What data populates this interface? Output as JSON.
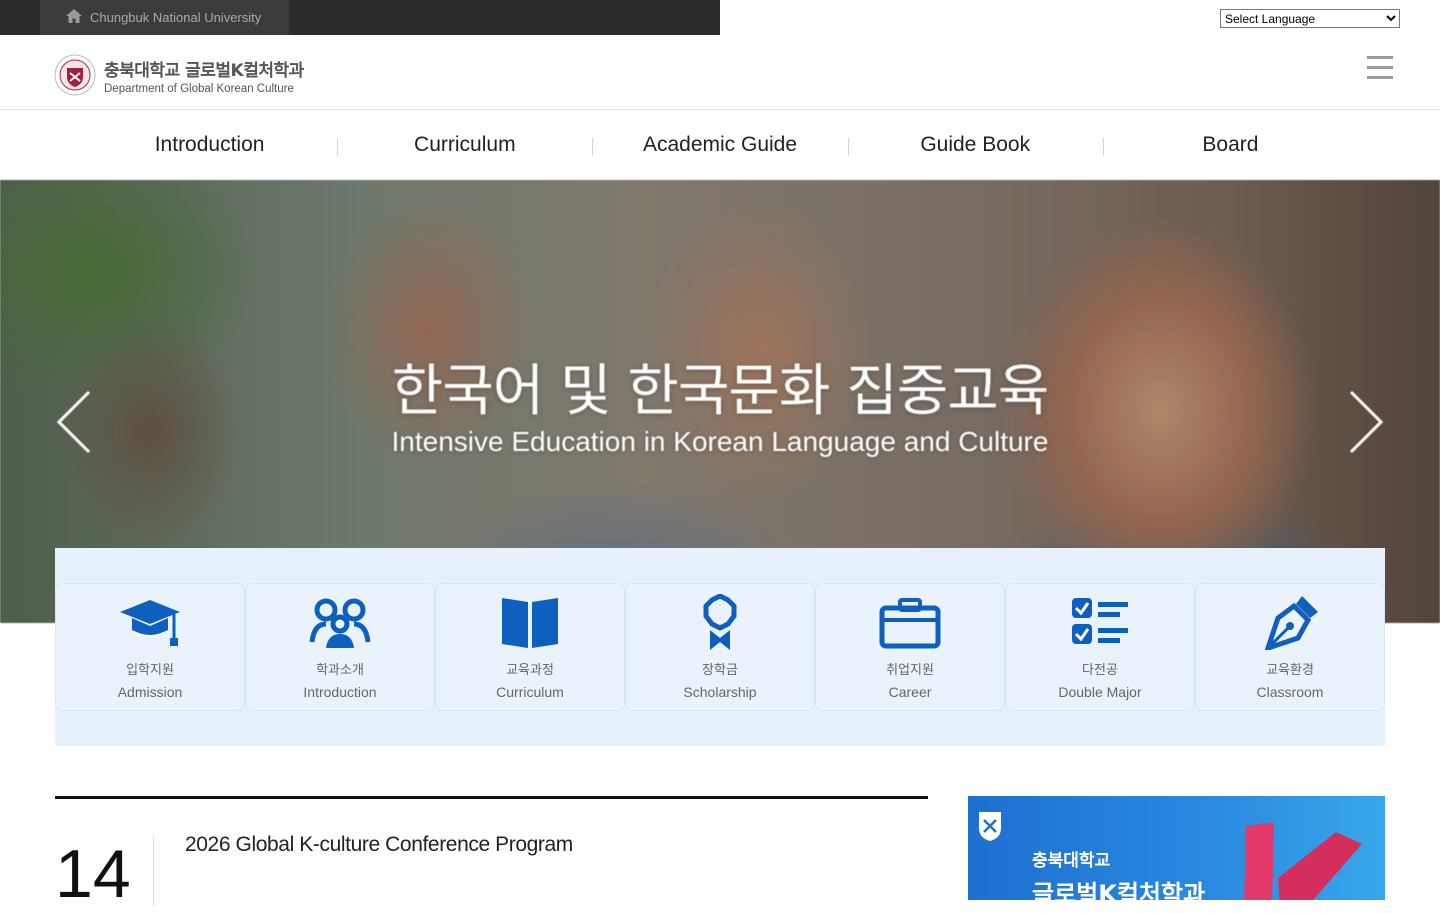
{
  "topbar": {
    "home_label": "Chungbuk National University"
  },
  "language_select": {
    "selected": "Select Language"
  },
  "header": {
    "logo_kr_main": "충북대학교",
    "logo_kr_dept": "글로벌K컬처학과",
    "logo_en": "Department of Global Korean Culture"
  },
  "nav": {
    "items": [
      {
        "label": "Introduction"
      },
      {
        "label": "Curriculum"
      },
      {
        "label": "Academic Guide"
      },
      {
        "label": "Guide Book"
      },
      {
        "label": "Board"
      }
    ]
  },
  "hero": {
    "title": "한국어 및 한국문화 집중교육",
    "subtitle": "Intensive Education in Korean Language and Culture"
  },
  "quick_links": [
    {
      "kr": "입학지원",
      "en": "Admission",
      "icon": "graduation-cap-icon"
    },
    {
      "kr": "학과소개",
      "en": "Introduction",
      "icon": "people-icon"
    },
    {
      "kr": "교육과정",
      "en": "Curriculum",
      "icon": "book-icon"
    },
    {
      "kr": "장학금",
      "en": "Scholarship",
      "icon": "award-icon"
    },
    {
      "kr": "취업지원",
      "en": "Career",
      "icon": "briefcase-icon"
    },
    {
      "kr": "다전공",
      "en": "Double Major",
      "icon": "checklist-icon"
    },
    {
      "kr": "교육환경",
      "en": "Classroom",
      "icon": "pen-nib-icon"
    }
  ],
  "news": {
    "day": "14",
    "headline": "2026 Global K-culture Conference Program"
  },
  "banner": {
    "line1": "충북대학교",
    "line2": "글로벌K컬처학과"
  },
  "colors": {
    "accent_blue": "#0f5fbf",
    "quick_bg": "#e6f1fb",
    "topbar_bg": "#2c2c2c"
  }
}
